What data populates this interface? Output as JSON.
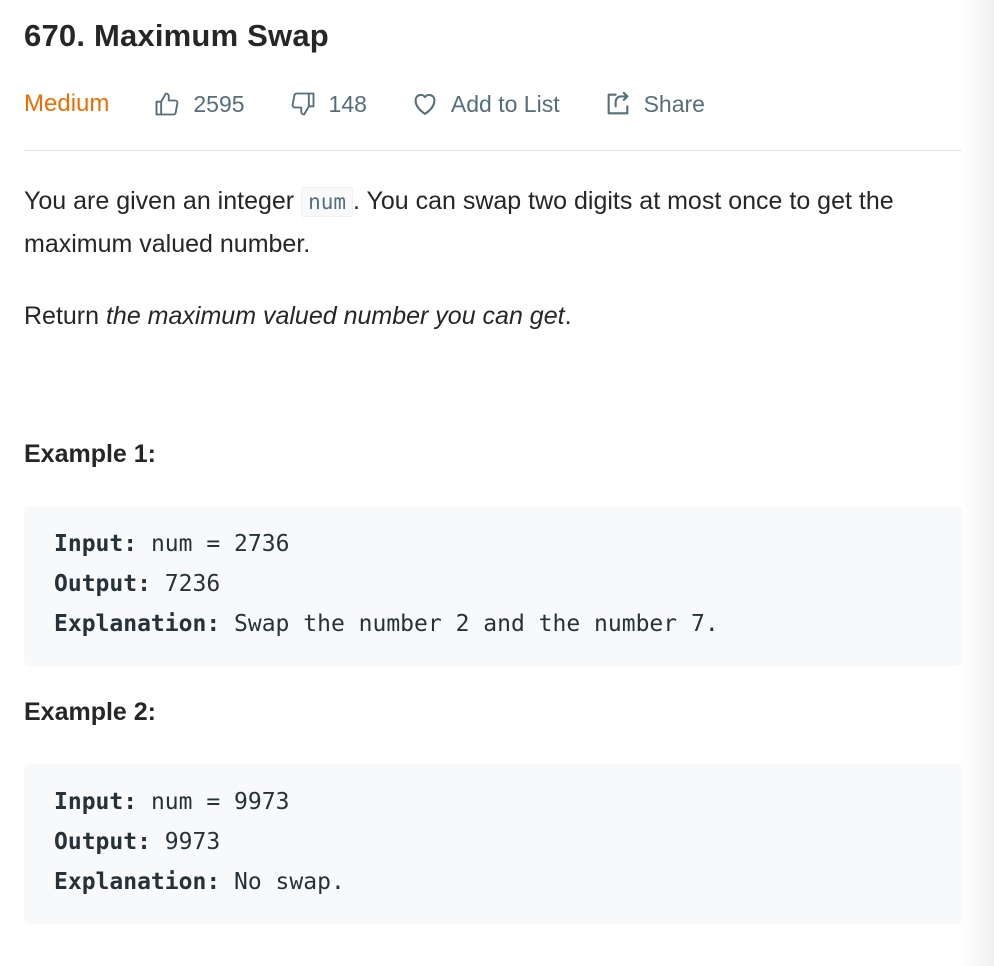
{
  "problem": {
    "title": "670. Maximum Swap",
    "difficulty": "Medium",
    "likes": "2595",
    "dislikes": "148",
    "add_to_list_label": "Add to List",
    "share_label": "Share"
  },
  "description": {
    "p1_before": "You are given an integer ",
    "p1_code": "num",
    "p1_after": ". You can swap two digits at most once to get the maximum valued number.",
    "p2_before": "Return ",
    "p2_italic": "the maximum valued number you can get",
    "p2_after": "."
  },
  "examples": [
    {
      "title": "Example 1:",
      "input_label": "Input:",
      "input_value": " num = 2736",
      "output_label": "Output:",
      "output_value": " 7236",
      "explanation_label": "Explanation:",
      "explanation_value": " Swap the number 2 and the number 7."
    },
    {
      "title": "Example 2:",
      "input_label": "Input:",
      "input_value": " num = 9973",
      "output_label": "Output:",
      "output_value": " 9973",
      "explanation_label": "Explanation:",
      "explanation_value": " No swap."
    }
  ],
  "icons": {
    "like": "thumbs-up-icon",
    "dislike": "thumbs-down-icon",
    "add_to_list": "heart-icon",
    "share": "share-icon"
  },
  "colors": {
    "difficulty_medium": "#ef6c00",
    "meta_text": "#546e7a",
    "code_background": "#f7f9fa"
  }
}
